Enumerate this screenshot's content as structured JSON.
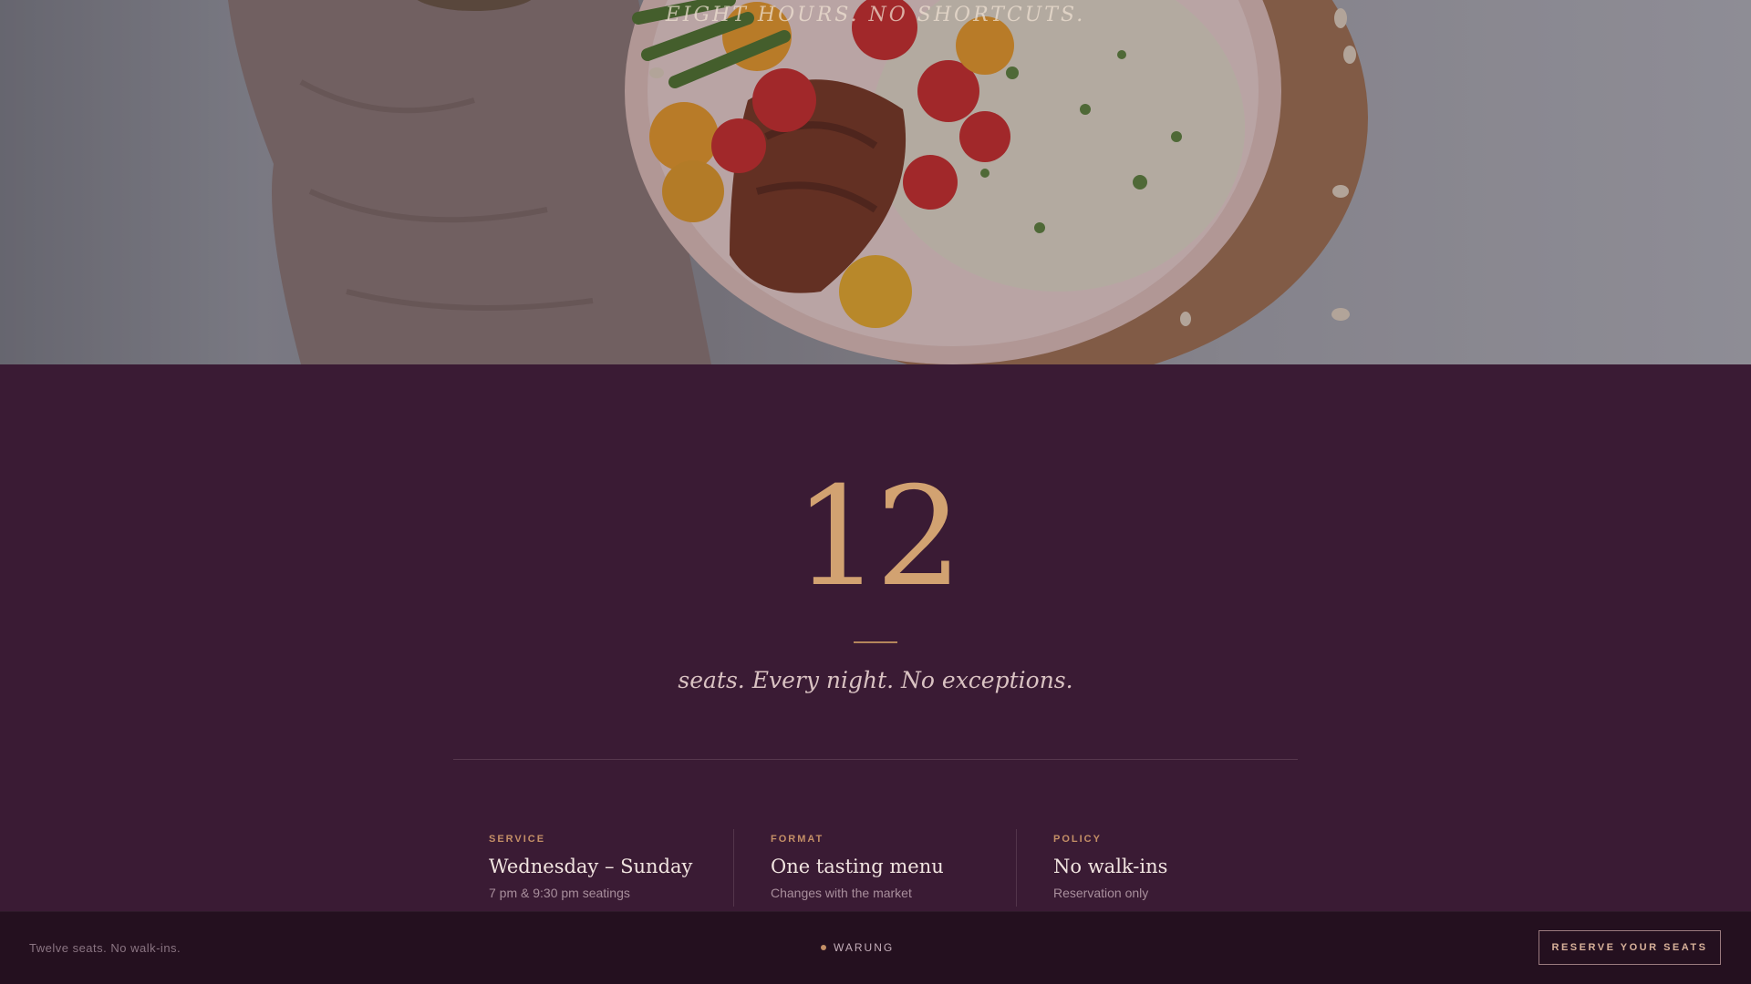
{
  "hero": {
    "image_description_icon": "food-plate-photo",
    "tagline": "EIGHT HOURS. NO SHORTCUTS."
  },
  "main": {
    "seat_count": "12",
    "tagline": "seats. Every night. No exceptions.",
    "info": [
      {
        "label": "SERVICE",
        "title": "Wednesday – Sunday",
        "sub": "7 pm & 9:30 pm seatings"
      },
      {
        "label": "FORMAT",
        "title": "One tasting menu",
        "sub": "Changes with the market"
      },
      {
        "label": "POLICY",
        "title": "No walk-ins",
        "sub": "Reservation only"
      }
    ]
  },
  "footer": {
    "left_text": "Twelve seats. No walk-ins.",
    "brand": "WARUNG",
    "reserve_label": "RESERVE YOUR SEATS"
  },
  "colors": {
    "background": "#3a1b34",
    "footer_bg": "#24101f",
    "accent": "#d2a271"
  }
}
